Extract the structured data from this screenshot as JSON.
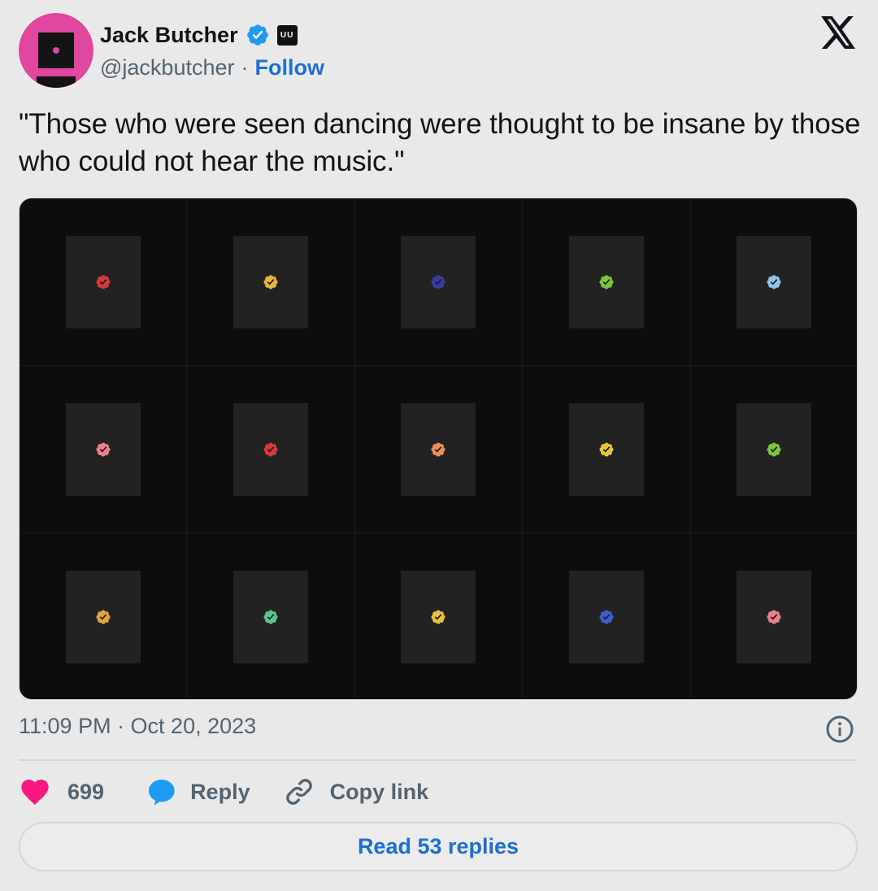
{
  "author": {
    "name": "Jack Butcher",
    "handle": "@jackbutcher",
    "separator": "·",
    "follow_label": "Follow",
    "verified_icon": "verified-badge-icon",
    "affiliate_badge_text": "UU",
    "avatar_color": "#e0479e"
  },
  "tweet": {
    "text": "\"Those who were seen dancing were thought to be insane by those who could not hear the music.\"",
    "timestamp": "11:09 PM · Oct 20, 2023"
  },
  "media": {
    "background": "#0d0d0d",
    "seal_colors": [
      "#d63a3a",
      "#e6b53c",
      "#3a3aa6",
      "#7cc43a",
      "#8cc8ea",
      "#ee7f8c",
      "#d63a3a",
      "#ee9055",
      "#e8c23c",
      "#7cc43a",
      "#e8a23c",
      "#55c88f",
      "#e8c23c",
      "#3a5fd0",
      "#ee7f8c"
    ]
  },
  "actions": {
    "like_count": "699",
    "reply_label": "Reply",
    "copy_label": "Copy link",
    "read_replies_label": "Read 53 replies"
  },
  "colors": {
    "accent": "#1d6fd0",
    "verified": "#1d9bf0",
    "like": "#f91880",
    "muted": "#536471"
  }
}
